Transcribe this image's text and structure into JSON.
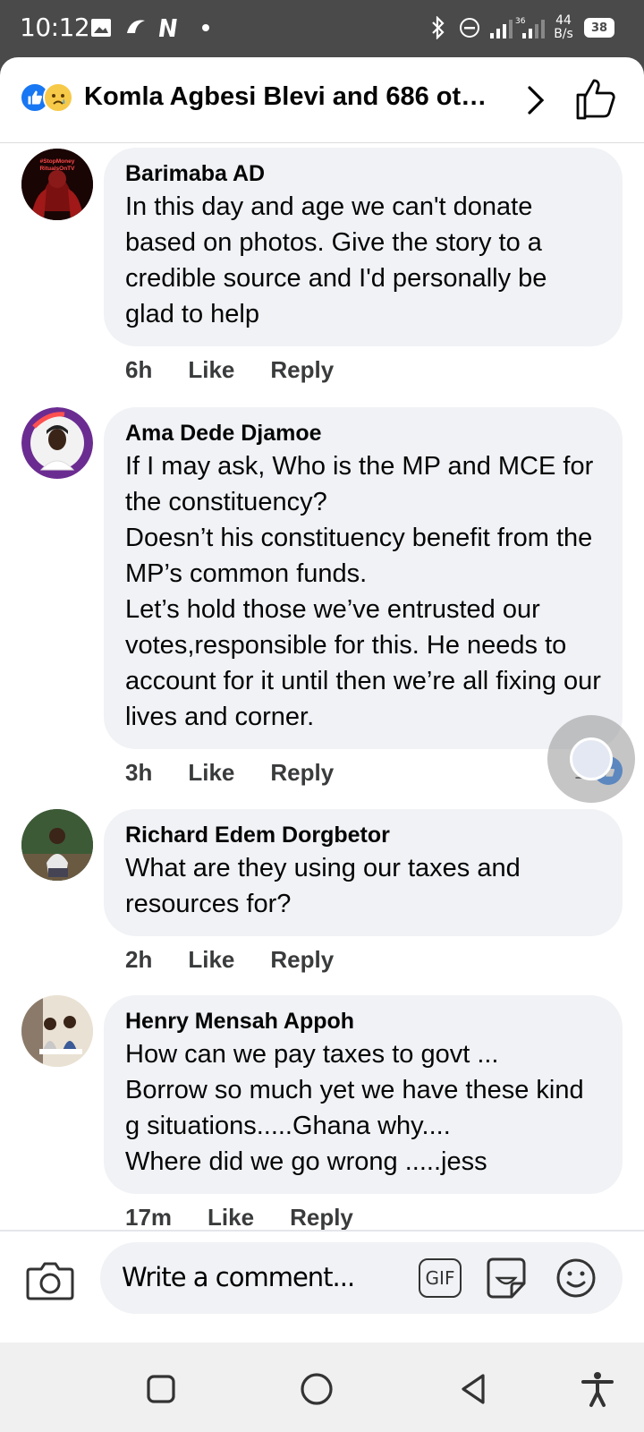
{
  "status_bar": {
    "time": "10:12",
    "network_speed": "44\nB/s",
    "battery": "38",
    "signal_label": "36"
  },
  "header": {
    "title": "Komla Agbesi Blevi and 686 ot…",
    "reaction_icons": [
      "like-icon",
      "sad-icon"
    ]
  },
  "comments": [
    {
      "author": "Barimaba AD",
      "text": "In this day and age we can't donate based on photos. Give the story to a credible source and I'd personally be glad to help",
      "time": "6h",
      "like_label": "Like",
      "reply_label": "Reply",
      "avatar_label": "#StopMoney RitualsOnTV"
    },
    {
      "author": "Ama Dede Djamoe",
      "text": "If I may ask, Who is the MP and MCE for the constituency?\nDoesn’t his constituency  benefit from the MP’s common funds.\nLet’s hold those we’ve entrusted our votes,responsible for this. He needs to account for it until then we’re all fixing our lives and corner.",
      "time": "3h",
      "like_label": "Like",
      "reply_label": "Reply",
      "like_count": "1",
      "avatar_label": "YEAR OF THE NURSE & MIDWIFE 2020"
    },
    {
      "author": "Richard Edem Dorgbetor",
      "text": "What are they using our taxes and resources for?",
      "time": "2h",
      "like_label": "Like",
      "reply_label": "Reply"
    },
    {
      "author": "Henry Mensah Appoh",
      "text": "How can we pay taxes to govt ...\nBorrow so much yet we have these kind g situations.....Ghana why....\nWhere did we go wrong .....jess",
      "time": "17m",
      "like_label": "Like",
      "reply_label": "Reply"
    }
  ],
  "composer": {
    "placeholder": "Write a comment...",
    "gif_label": "GIF"
  },
  "colors": {
    "facebook_blue": "#1877f2",
    "bubble_bg": "#f0f2f5",
    "status_bar_bg": "#4a4a4a"
  }
}
